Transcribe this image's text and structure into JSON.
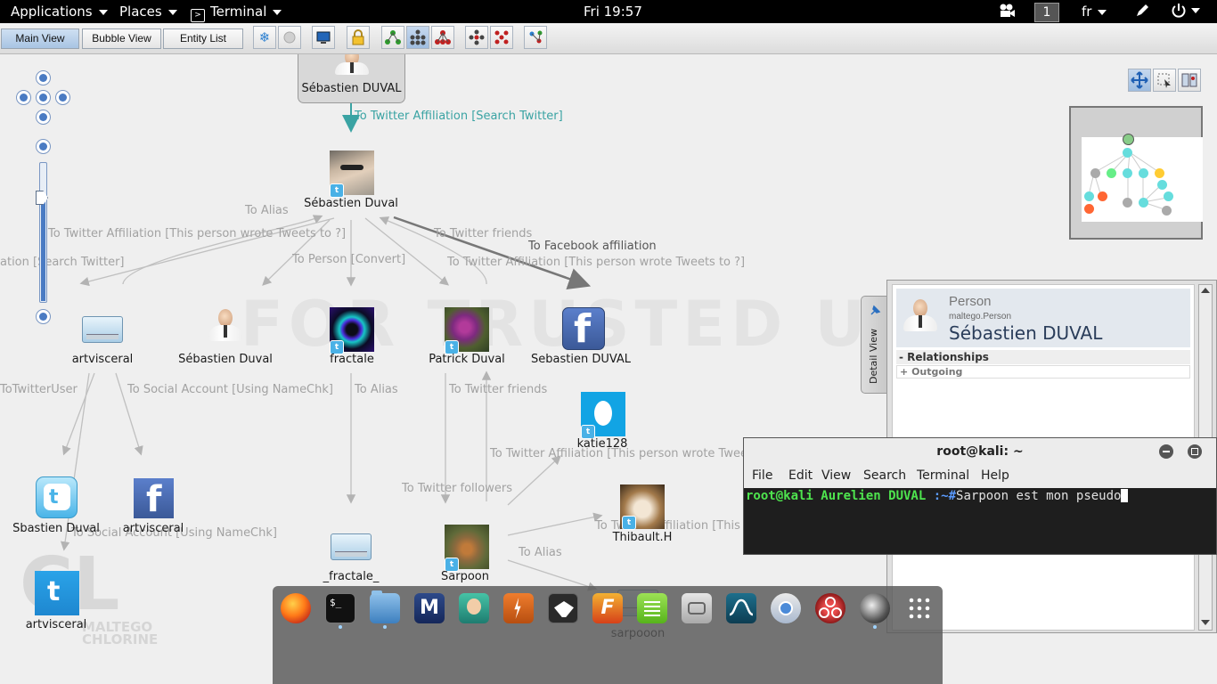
{
  "topbar": {
    "applications": "Applications",
    "places": "Places",
    "terminal": "Terminal",
    "clock": "Fri 19:57",
    "workspace": "1",
    "language": "fr"
  },
  "toolbar": {
    "main_view": "Main View",
    "bubble_view": "Bubble View",
    "entity_list": "Entity List"
  },
  "graph": {
    "nodes": {
      "root": "Sébastien DUVAL",
      "sebastien": "Sébastien Duval",
      "artvisceral": "artvisceral",
      "sebastien_person": "Sébastien Duval",
      "fractale": "fractale",
      "patrick": "Patrick Duval",
      "facebook": "Sebastien DUVAL",
      "katie": "katie128",
      "sbastien": "Sbastien Duval",
      "artvisceral_fb": "artvisceral",
      "artvisceral_tw": "artvisceral",
      "fractale2": "_fractale_",
      "sarpoon": "Sarpoon",
      "thibault": "Thibault.H",
      "sarpooon": "sarpooon"
    },
    "edges": {
      "twitter_affiliation_search": "To Twitter Affiliation [Search Twitter]",
      "to_alias": "To Alias",
      "tweets_to_left": "To Twitter Affiliation [This person wrote Tweets to ?]",
      "twitter_friends_top": "To Twitter friends",
      "facebook_affiliation": "To Facebook affiliation",
      "search_twitter_cut": "ation [Search Twitter]",
      "person_convert": "To Person [Convert]",
      "tweets_to_right": "To Twitter Affiliation [This person wrote Tweets to ?]",
      "to_twitter_user": "ToTwitterUser",
      "social_account": "To Social Account [Using NameChk]",
      "to_alias_2": "To Alias",
      "twitter_friends_2": "To Twitter friends",
      "tweets_to_3": "To Twitter Affiliation [This person wrote Tweet",
      "twitter_followers": "To Twitter followers",
      "social_account_2": "To Social Account [Using NameChk]",
      "tweets_to_4": "To Twitter Affiliation [This person wrote Tweets to ?]",
      "to_alias_3": "To Alias"
    }
  },
  "detail": {
    "type": "Person",
    "subtype": "maltego.Person",
    "name": "Sébastien DUVAL",
    "relationships": "Relationships",
    "outgoing": "Outgoing",
    "tab": "Detail View"
  },
  "terminal": {
    "title": "root@kali: ~",
    "menu": [
      "File",
      "Edit",
      "View",
      "Search",
      "Terminal",
      "Help"
    ],
    "prompt": "root@kali Aurelien DUVAL",
    "path": ":~#",
    "command": "Sarpoon est mon pseudo"
  },
  "colors": {
    "edge_twitter": "#3aa3a3",
    "prompt_green": "#4ee44e",
    "desktop_bg": "#efefef"
  }
}
